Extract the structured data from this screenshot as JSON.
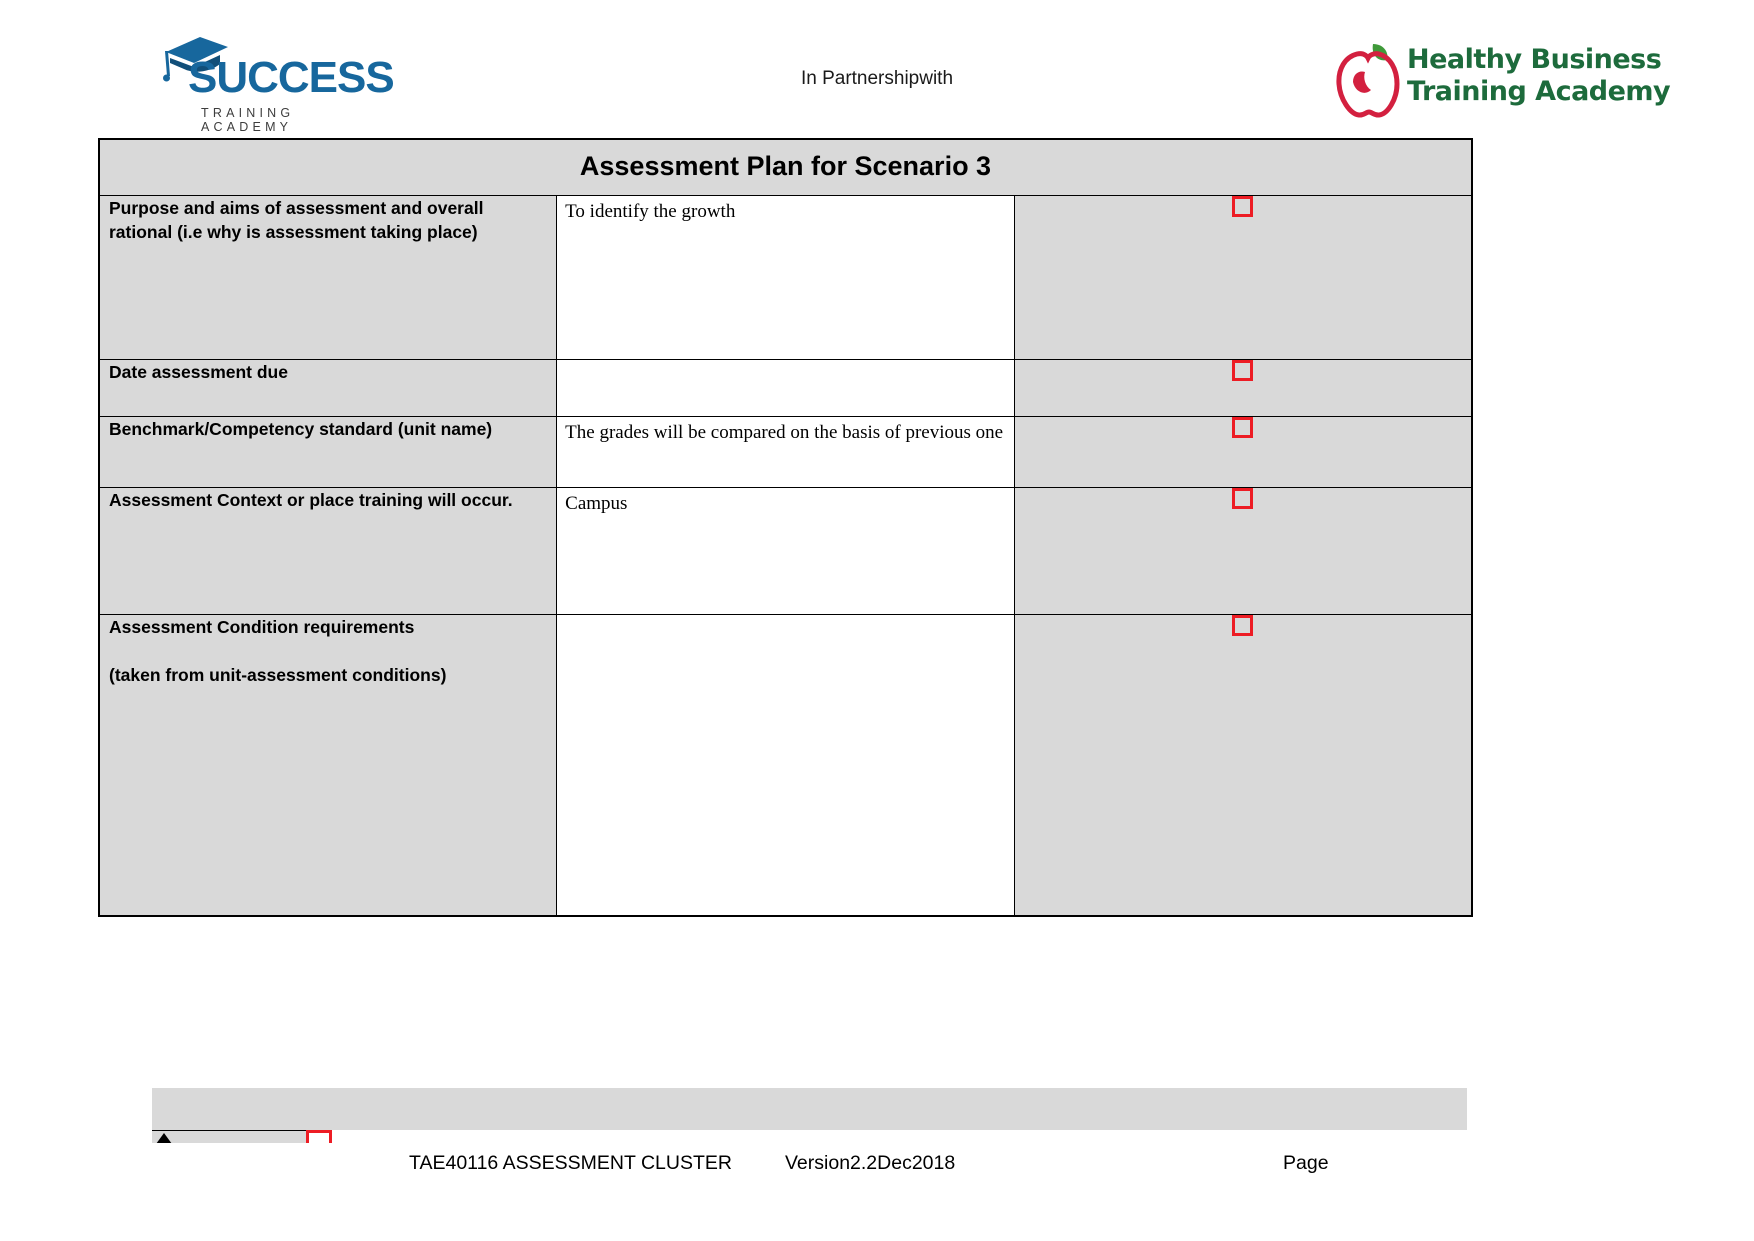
{
  "header": {
    "partnership_text": "In Partnershipwith",
    "left_logo": {
      "name": "success-training-academy-logo",
      "wordmark": "SUCCESS",
      "subtitle": "TRAINING ACADEMY",
      "color": "#17679d",
      "icon": "graduation-cap-icon"
    },
    "right_logo": {
      "name": "healthy-business-training-academy-logo",
      "line1": "Healthy Business",
      "line2": "Training Academy",
      "text_color": "#1d6b3c",
      "apple_color": "#d3203f",
      "leaf_color": "#3f9a3a",
      "icon": "apple-icon"
    }
  },
  "table": {
    "title": "Assessment Plan for Scenario 3",
    "header_bg": "#d9d9d9",
    "checkbox_color": "#ed1c24",
    "rows": [
      {
        "label": "Purpose and aims of assessment and overall rational (i.e why is assessment taking place)",
        "content": "To identify the growth",
        "checkbox": "unchecked"
      },
      {
        "label": "Date assessment due",
        "content": "",
        "checkbox": "unchecked"
      },
      {
        "label": "Benchmark/Competency standard (unit name)",
        "content": "The grades will be compared on the basis of previous one",
        "checkbox": "unchecked"
      },
      {
        "label": "Assessment Context or place training will occur.",
        "content": "Campus",
        "checkbox": "unchecked"
      },
      {
        "label_part1": "Assessment Condition requirements",
        "label_part2": "(taken from unit-assessment conditions)",
        "content": "",
        "checkbox": "unchecked"
      }
    ]
  },
  "footer": {
    "cluster": "TAE40116 ASSESSMENT CLUSTER",
    "version": "Version2.2Dec2018",
    "page": "Page"
  }
}
